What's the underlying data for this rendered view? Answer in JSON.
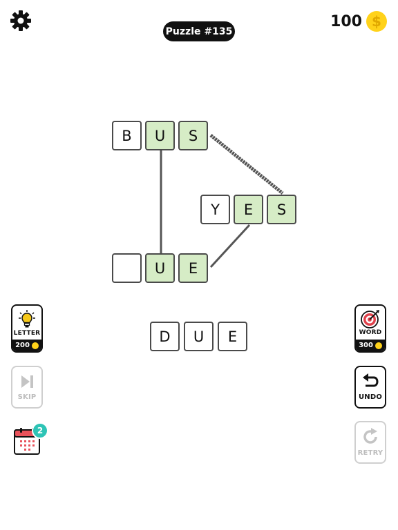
{
  "header": {
    "puzzle_title": "Puzzle #135",
    "coins": "100",
    "coin_symbol": "$"
  },
  "board": {
    "word_row1": [
      "B",
      "U",
      "S"
    ],
    "word_row2": [
      "Y",
      "E",
      "S"
    ],
    "word_row3": [
      "",
      "U",
      "E"
    ]
  },
  "input": {
    "letters": [
      "D",
      "U",
      "E"
    ]
  },
  "buttons": {
    "letter": {
      "label": "LETTER",
      "cost": "200"
    },
    "word": {
      "label": "WORD",
      "cost": "300"
    },
    "skip": {
      "label": "SKIP"
    },
    "undo": {
      "label": "UNDO"
    },
    "retry": {
      "label": "RETRY"
    },
    "calendar_badge": "2"
  },
  "colors": {
    "accent_green": "#d6ecc6",
    "coin_gold": "#ffd21a",
    "badge_teal": "#2ec4b6",
    "bulb_yellow": "#f7c91a",
    "target_red": "#e0414b"
  },
  "icons": [
    "gear-icon",
    "coin-icon",
    "lightbulb-icon",
    "target-icon",
    "skip-icon",
    "undo-icon",
    "retry-icon",
    "calendar-icon"
  ]
}
